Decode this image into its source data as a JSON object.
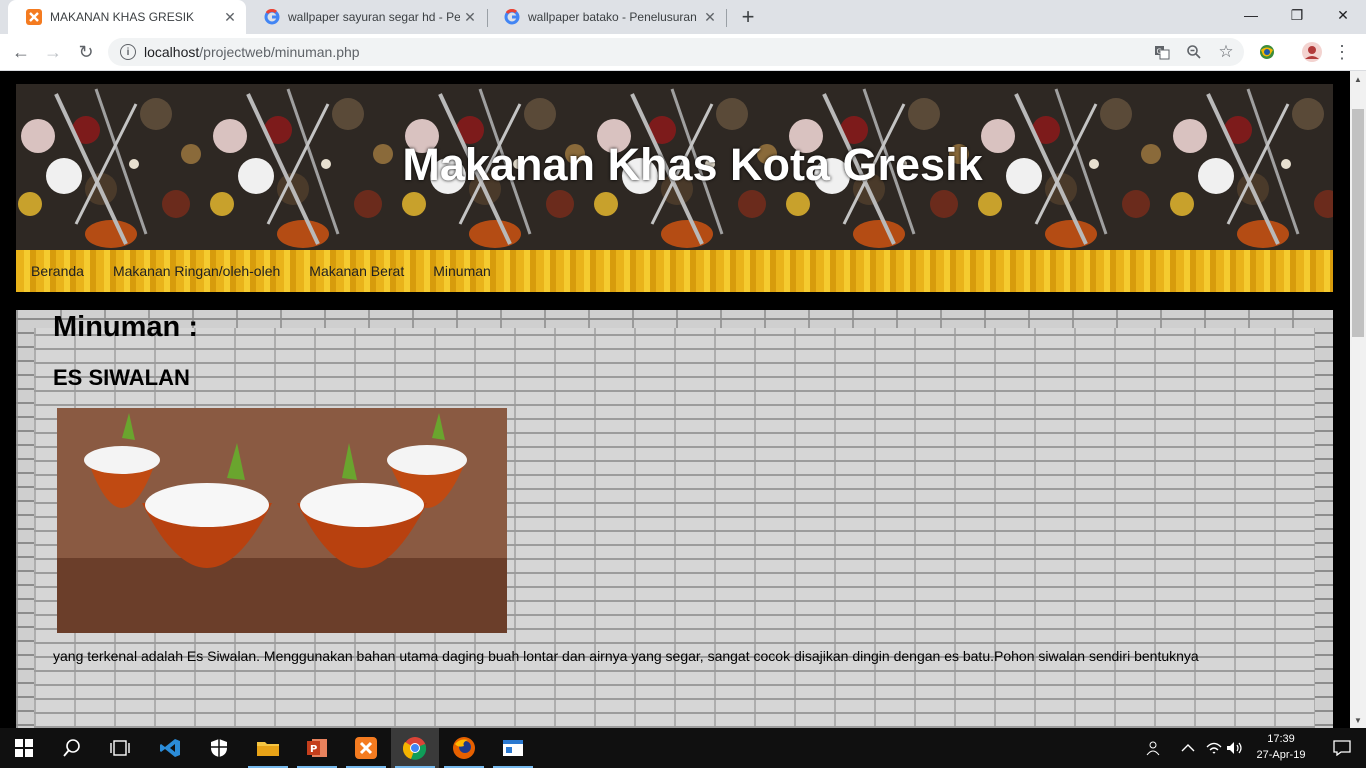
{
  "browser": {
    "tabs": [
      {
        "title": "MAKANAN KHAS GRESIK",
        "active": true
      },
      {
        "title": "wallpaper sayuran segar hd - Pen",
        "active": false
      },
      {
        "title": "wallpaper batako - Penelusuran G",
        "active": false
      }
    ],
    "url_host": "localhost",
    "url_path": "/projectweb/minuman.php"
  },
  "page": {
    "site_title": "Makanan Khas Kota Gresik",
    "nav": [
      "Beranda",
      "Makanan Ringan/oleh-oleh",
      "Makanan Berat",
      "Minuman"
    ],
    "section_title": "Minuman :",
    "item_title": "ES SIWALAN",
    "description": "yang terkenal adalah Es Siwalan. Menggunakan bahan utama daging buah lontar dan airnya yang segar, sangat cocok disajikan dingin dengan es batu.Pohon siwalan sendiri bentuknya"
  },
  "taskbar": {
    "time": "17:39",
    "date": "27-Apr-19"
  },
  "colors": {
    "tab_bar": "#dee1e6",
    "accent_blue": "#76b9ed",
    "nav_yellow": "#f5cb2f"
  }
}
